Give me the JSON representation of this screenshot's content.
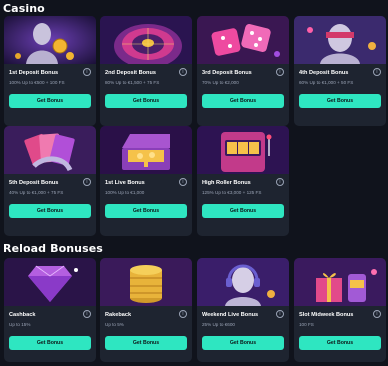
{
  "sections": {
    "casino": {
      "title": "Casino"
    },
    "reload": {
      "title": "Reload Bonuses"
    }
  },
  "button_label": "Get Bonus",
  "info_glyph": "i",
  "cards": [
    {
      "title": "1st Deposit Bonus",
      "sub": "100% Up to €500 + 100 FS",
      "art": "statue-gold"
    },
    {
      "title": "2nd Deposit Bonus",
      "sub": "80% Up to €1,500 + 75 FS",
      "art": "roulette"
    },
    {
      "title": "3rd Deposit Bonus",
      "sub": "70% Up to €2,000",
      "art": "dice"
    },
    {
      "title": "4th Deposit Bonus",
      "sub": "60% Up to €1,000 + 50 FS",
      "art": "statue-blindfold"
    },
    {
      "title": "5th Deposit Bonus",
      "sub": "40% Up to €1,000 + 75 FS",
      "art": "cards"
    },
    {
      "title": "1st Live Bonus",
      "sub": "100% Up to €1,000",
      "art": "chest"
    },
    {
      "title": "High Roller Bonus",
      "sub": "125% Up to €3,000 + 125 FS",
      "art": "slot"
    },
    {
      "title": "Cashback",
      "sub": "Up to 15%",
      "art": "diamond"
    },
    {
      "title": "Rakeback",
      "sub": "Up to 5%",
      "art": "chips"
    },
    {
      "title": "Weekend Live Bonus",
      "sub": "25% Up to €600",
      "art": "statue-headphones"
    },
    {
      "title": "Slot Midweek Bonus",
      "sub": "100 FS",
      "art": "gift"
    }
  ],
  "colors": {
    "background": "#10131c",
    "card": "#1e2430",
    "button": "#2ee6c1",
    "muted_text": "#9aa3b5"
  }
}
